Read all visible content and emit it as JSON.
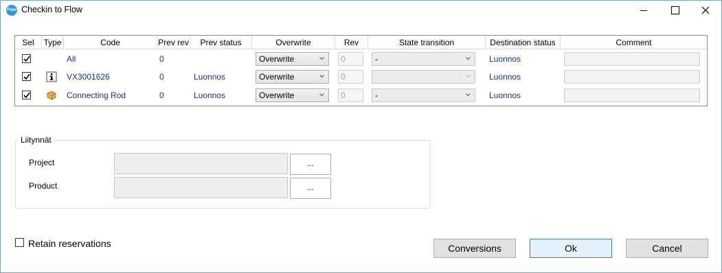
{
  "window": {
    "title": "Checkin to Flow",
    "app_icon_text": "Flow"
  },
  "grid": {
    "columns": [
      "Sel",
      "Type",
      "Code",
      "Prev rev",
      "Prev status",
      "Overwrite",
      "Rev",
      "State transition",
      "Destination status",
      "Comment"
    ],
    "rows": [
      {
        "selected": true,
        "type_icon": "",
        "code": "All",
        "prev_rev": "0",
        "prev_status": "",
        "overwrite": "Overwrite",
        "rev": "0",
        "state_transition": "-",
        "state_enabled": true,
        "destination_status": "Luonnos",
        "comment": ""
      },
      {
        "selected": true,
        "type_icon": "info-icon",
        "code": "VX3001626",
        "prev_rev": "0",
        "prev_status": "Luonnos",
        "overwrite": "Overwrite",
        "rev": "0",
        "state_transition": "",
        "state_enabled": false,
        "destination_status": "Luonnos",
        "comment": ""
      },
      {
        "selected": true,
        "type_icon": "part-icon",
        "code": "Connecting Rod",
        "prev_rev": "0",
        "prev_status": "Luonnos",
        "overwrite": "Overwrite",
        "rev": "0",
        "state_transition": "-",
        "state_enabled": true,
        "destination_status": "Luonnos",
        "comment": ""
      }
    ]
  },
  "links": {
    "legend": "Liitynnät",
    "project_label": "Project",
    "product_label": "Product",
    "browse_label": "..."
  },
  "footer": {
    "retain_label": "Retain reservations",
    "retain_checked": false,
    "conversions_label": "Conversions",
    "ok_label": "Ok",
    "cancel_label": "Cancel"
  },
  "colors": {
    "link_text": "#1a2f8a",
    "app_icon": "#2c9bd6",
    "default_button_border": "#3c7fb1"
  }
}
